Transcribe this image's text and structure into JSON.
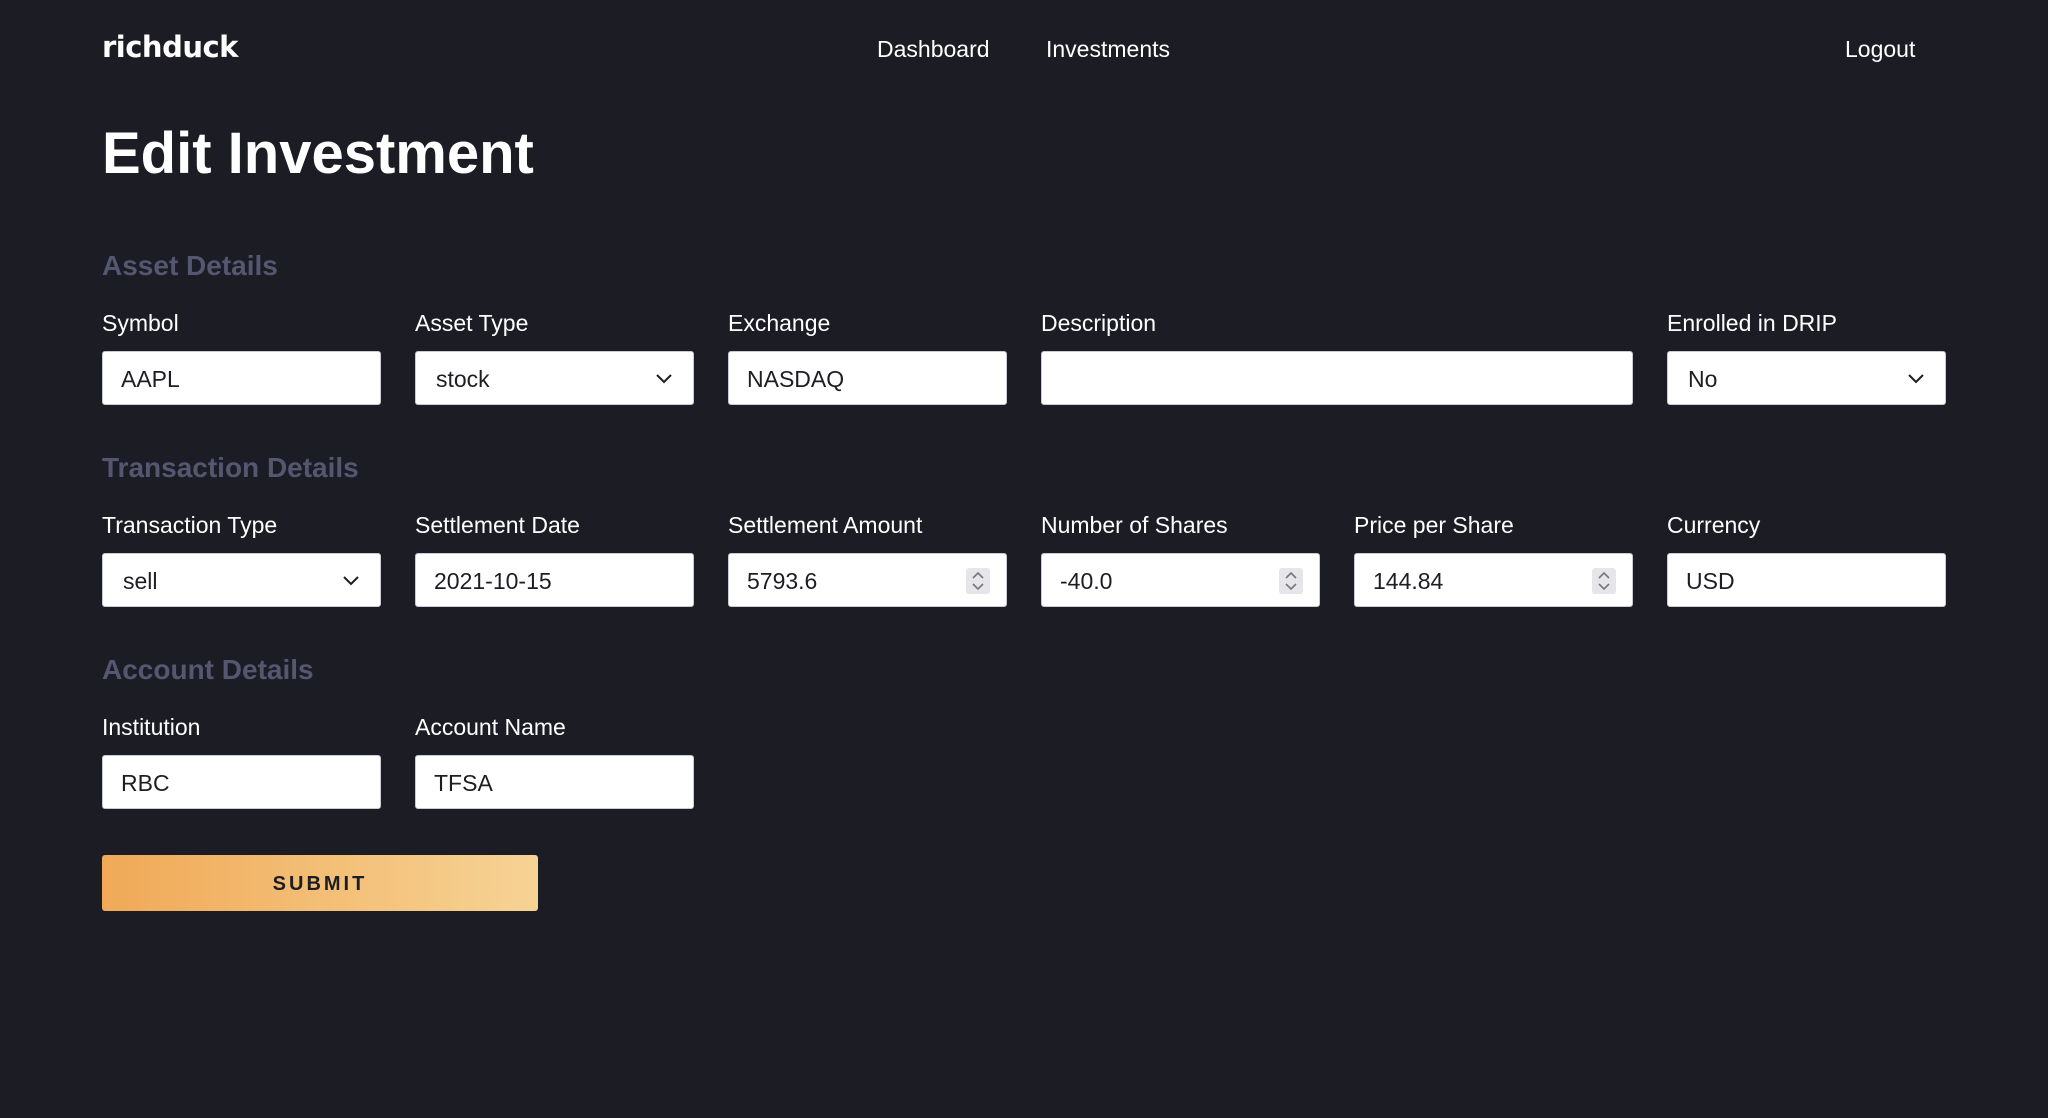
{
  "nav": {
    "brand": "richduck",
    "dashboard": "Dashboard",
    "investments": "Investments",
    "logout": "Logout"
  },
  "page": {
    "title": "Edit Investment"
  },
  "asset_details": {
    "heading": "Asset Details",
    "symbol": {
      "label": "Symbol",
      "value": "AAPL"
    },
    "asset_type": {
      "label": "Asset Type",
      "value": "stock"
    },
    "exchange": {
      "label": "Exchange",
      "value": "NASDAQ"
    },
    "description": {
      "label": "Description",
      "value": ""
    },
    "drip": {
      "label": "Enrolled in DRIP",
      "value": "No"
    }
  },
  "transaction_details": {
    "heading": "Transaction Details",
    "transaction_type": {
      "label": "Transaction Type",
      "value": "sell"
    },
    "settlement_date": {
      "label": "Settlement Date",
      "value": "2021-10-15"
    },
    "settlement_amount": {
      "label": "Settlement Amount",
      "value": "5793.6"
    },
    "shares": {
      "label": "Number of Shares",
      "value": "-40.0"
    },
    "price": {
      "label": "Price per Share",
      "value": "144.84"
    },
    "currency": {
      "label": "Currency",
      "value": "USD"
    }
  },
  "account_details": {
    "heading": "Account Details",
    "institution": {
      "label": "Institution",
      "value": "RBC"
    },
    "account_name": {
      "label": "Account Name",
      "value": "TFSA"
    }
  },
  "form": {
    "submit_label": "SUBMIT"
  },
  "colors": {
    "background": "#1c1c25",
    "section_heading": "#555770",
    "submit_gradient_start": "#f0a957",
    "submit_gradient_end": "#f6d394"
  },
  "icons": {
    "select_arrow": "chevron-down-icon",
    "number_spinner": "spinner-icon"
  }
}
